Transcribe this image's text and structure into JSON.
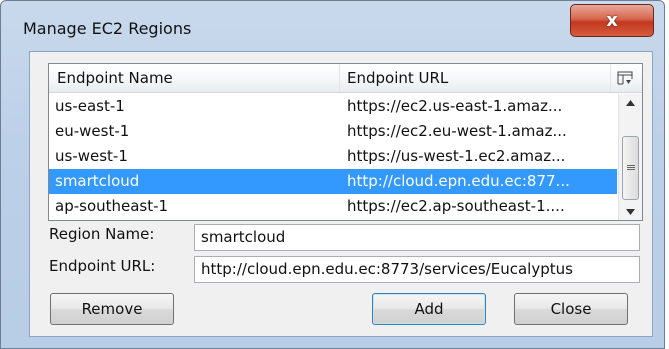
{
  "window": {
    "title": "Manage EC2 Regions",
    "close_glyph": "x"
  },
  "table": {
    "headers": {
      "name": "Endpoint Name",
      "url": "Endpoint URL"
    },
    "rows": [
      {
        "name": "us-east-1",
        "url": "https://ec2.us-east-1.amaz..."
      },
      {
        "name": "eu-west-1",
        "url": "https://ec2.eu-west-1.amaz..."
      },
      {
        "name": "us-west-1",
        "url": "https://us-west-1.ec2.amaz..."
      },
      {
        "name": "smartcloud",
        "url": "http://cloud.epn.edu.ec:877..."
      },
      {
        "name": "ap-southeast-1",
        "url": "https://ec2.ap-southeast-1...."
      }
    ],
    "selected_index": 3
  },
  "form": {
    "region_label": "Region Name:",
    "region_value": "smartcloud",
    "endpoint_label": "Endpoint URL:",
    "endpoint_value": "http://cloud.epn.edu.ec:8773/services/Eucalyptus"
  },
  "buttons": {
    "remove": "Remove",
    "add": "Add",
    "close": "Close"
  },
  "colors": {
    "selection": "#3399ff",
    "close_button": "#c3391f"
  }
}
